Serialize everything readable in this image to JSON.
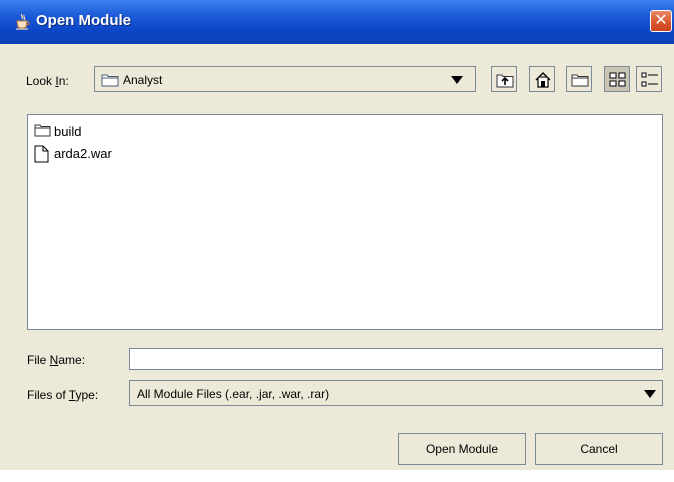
{
  "window": {
    "title": "Open Module",
    "close_glyph": "✕",
    "accent_color": "#0a46c6",
    "close_color": "#d9542d"
  },
  "look_in": {
    "label_pre": "Look ",
    "label_mnemonic": "I",
    "label_post": "n:",
    "value": "Analyst",
    "icon": "folder-icon"
  },
  "toolbar": {
    "buttons": [
      "up-one-level-icon",
      "home-icon",
      "new-folder-icon",
      "list-view-icon",
      "details-view-icon"
    ],
    "active": "list-view-icon"
  },
  "files": [
    {
      "name": "build",
      "icon": "folder-icon"
    },
    {
      "name": "arda2.war",
      "icon": "file-icon"
    }
  ],
  "file_name": {
    "label_pre": "File ",
    "label_mnemonic": "N",
    "label_post": "ame:",
    "value": "",
    "placeholder": ""
  },
  "files_of_type": {
    "label_pre": "Files of ",
    "label_mnemonic": "T",
    "label_post": "ype:",
    "value": "All Module Files (.ear, .jar, .war, .rar)"
  },
  "buttons": {
    "open": "Open Module",
    "cancel": "Cancel"
  }
}
